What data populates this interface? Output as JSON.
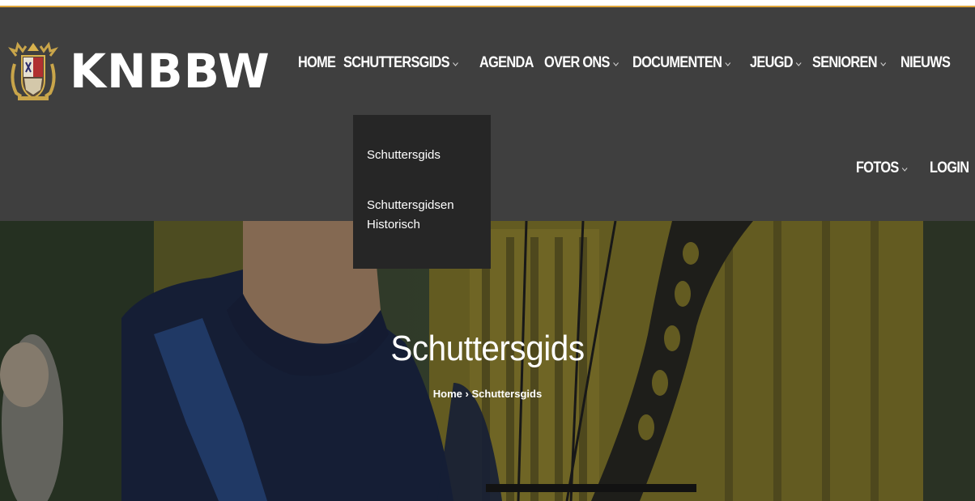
{
  "site": {
    "logo_text": "KNBBW",
    "accent_color": "#e0a63a",
    "header_bg": "#3f3f3f"
  },
  "nav": {
    "row1": [
      {
        "label": "HOME",
        "dropdown": false
      },
      {
        "label": "SCHUTTERSGIDS",
        "dropdown": true
      },
      {
        "label": "AGENDA",
        "dropdown": false
      },
      {
        "label": "OVER ONS",
        "dropdown": true
      },
      {
        "label": "DOCUMENTEN",
        "dropdown": true
      },
      {
        "label": "JEUGD",
        "dropdown": true
      },
      {
        "label": "SENIOREN",
        "dropdown": true
      },
      {
        "label": "NIEUWS",
        "dropdown": false
      }
    ],
    "row2": [
      {
        "label": "FOTOS",
        "dropdown": true
      },
      {
        "label": "LOGIN",
        "dropdown": false
      }
    ],
    "dropdown_icon": "chevron-down-icon"
  },
  "dropdown_menu": {
    "items": [
      "Schuttersgids",
      "Schuttersgidsen Historisch"
    ]
  },
  "hero": {
    "title": "Schuttersgids",
    "breadcrumb_home": "Home",
    "breadcrumb_sep": "›",
    "breadcrumb_current": "Schuttersgids"
  }
}
